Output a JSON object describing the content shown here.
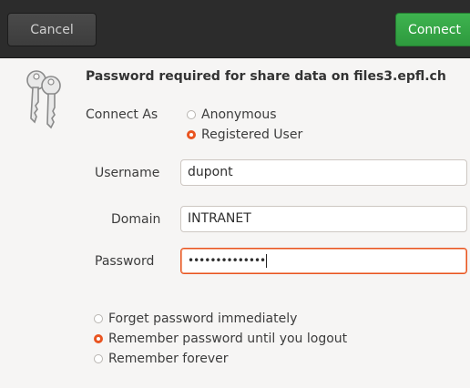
{
  "header": {
    "cancel_label": "Cancel",
    "connect_label": "Connect"
  },
  "dialog": {
    "title": "Password required for share data on files3.epfl.ch",
    "icon": "keys-icon",
    "connect_as_label": "Connect As",
    "connect_as_options": [
      {
        "label": "Anonymous",
        "checked": false
      },
      {
        "label": "Registered User",
        "checked": true
      }
    ],
    "username_label": "Username",
    "username_value": "dupont",
    "domain_label": "Domain",
    "domain_value": "INTRANET",
    "password_label": "Password",
    "password_masked": "••••••••••••••",
    "remember_options": [
      {
        "label": "Forget password immediately",
        "checked": false
      },
      {
        "label": "Remember password until you logout",
        "checked": true
      },
      {
        "label": "Remember forever",
        "checked": false
      }
    ]
  },
  "colors": {
    "accent": "#e95420",
    "connect_button": "#38a948",
    "headerbar": "#2c2c2c",
    "background": "#f6f5f4"
  }
}
